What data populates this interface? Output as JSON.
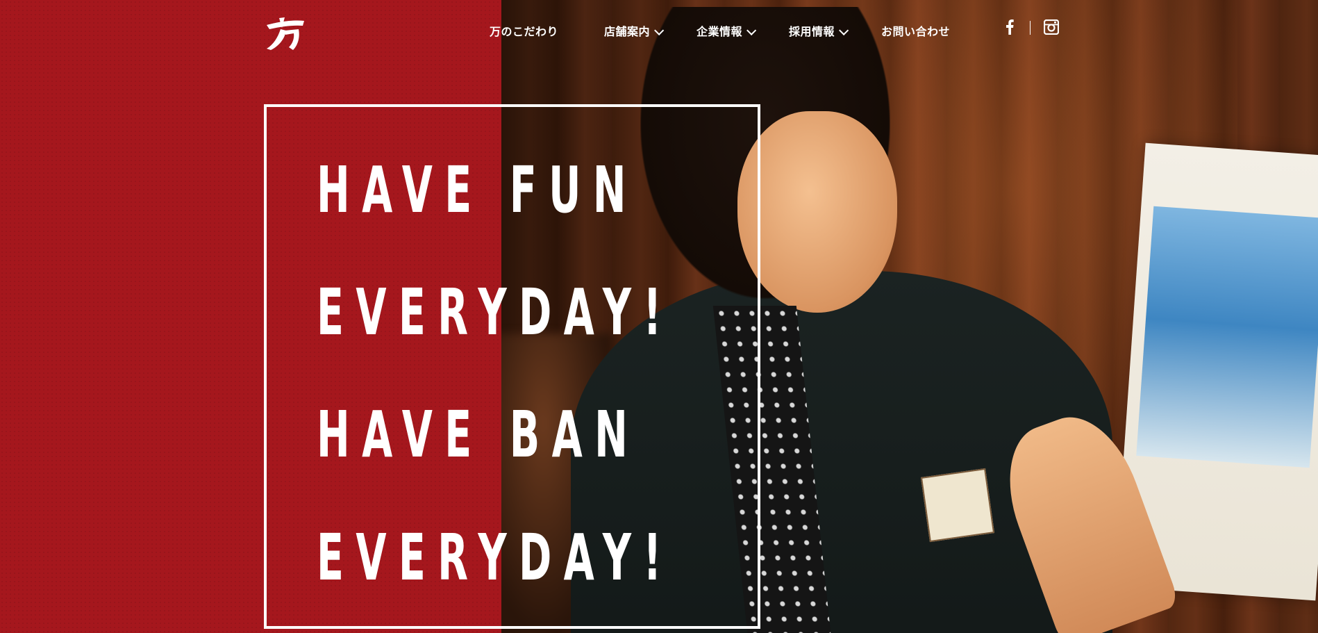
{
  "header": {
    "logo_alt": "万",
    "nav": [
      {
        "label": "万のこだわり",
        "has_dropdown": false
      },
      {
        "label": "店舗案内",
        "has_dropdown": true
      },
      {
        "label": "企業情報",
        "has_dropdown": true
      },
      {
        "label": "採用情報",
        "has_dropdown": true
      },
      {
        "label": "お問い合わせ",
        "has_dropdown": false
      }
    ],
    "social": [
      "facebook-icon",
      "instagram-icon"
    ]
  },
  "hero": {
    "lines": [
      "HAVE FUN",
      "EVERYDAY!",
      "HAVE BAN",
      "EVERYDAY!"
    ]
  },
  "colors": {
    "brand_red": "#a5171d",
    "text": "#ffffff"
  }
}
